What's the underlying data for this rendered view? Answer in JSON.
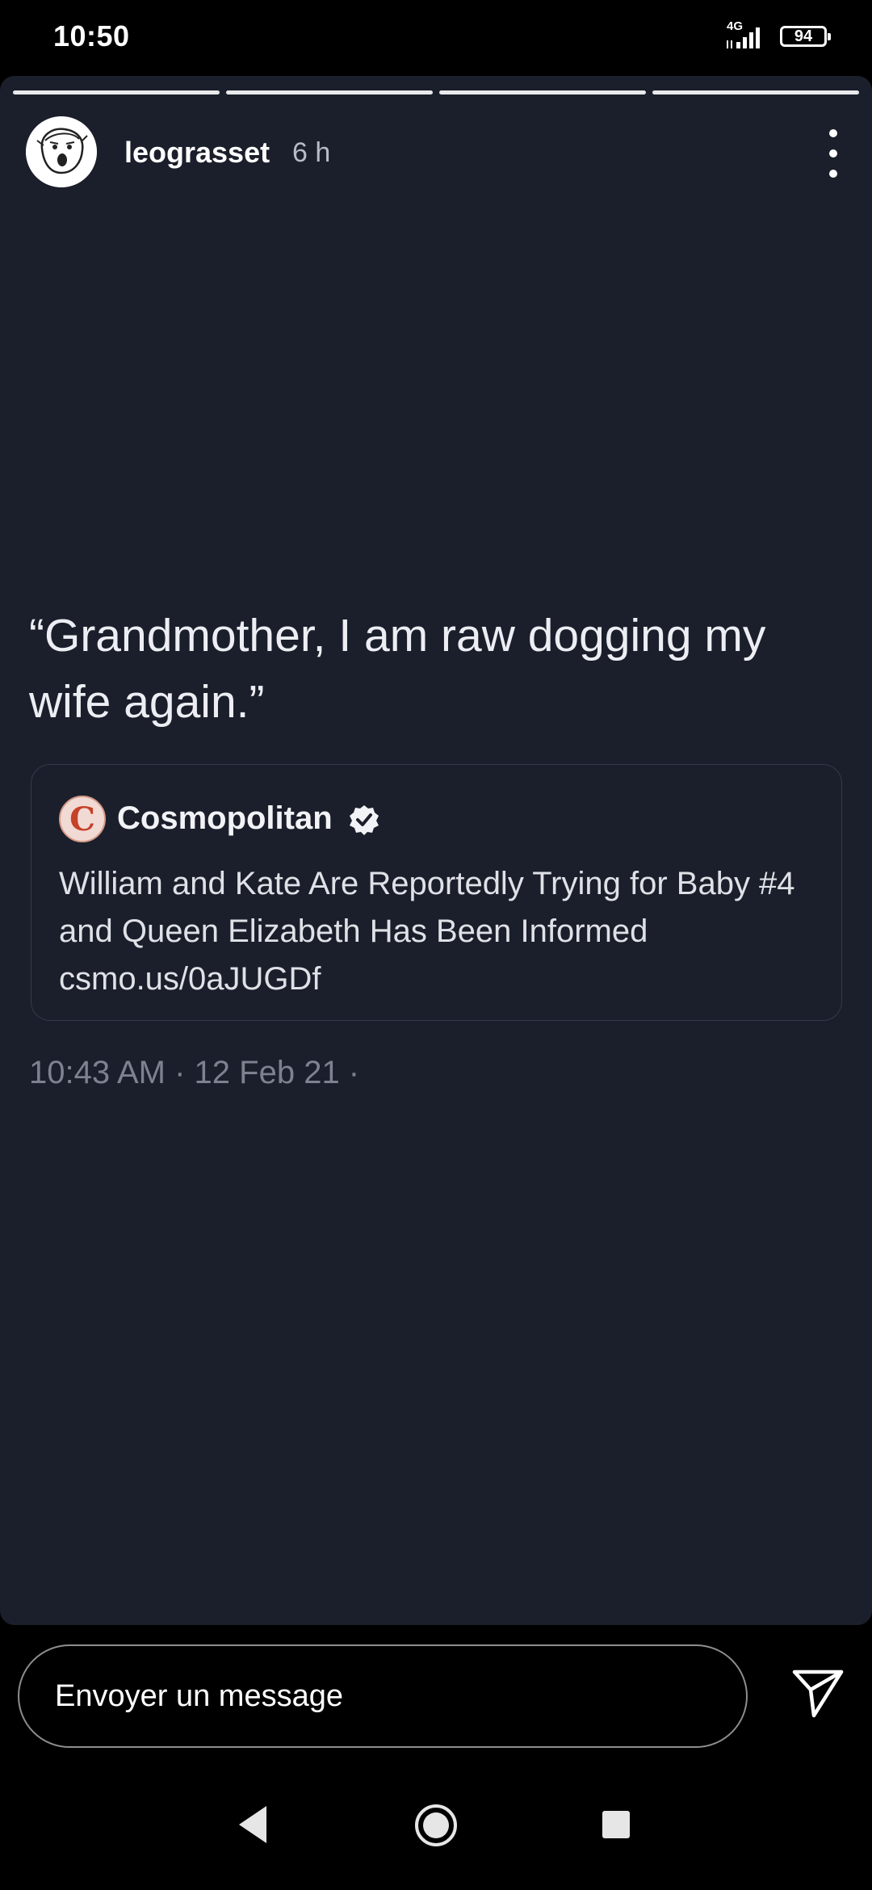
{
  "status_bar": {
    "time": "10:50",
    "network": "4G",
    "battery": "94"
  },
  "story": {
    "username": "leograsset",
    "time_ago": "6 h",
    "progress_segments": 4,
    "tweet": {
      "text": "“Grandmother, I am raw dogging my wife again.”",
      "quote": {
        "logo_letter": "C",
        "source": "Cosmopolitan",
        "body": "William and Kate Are Reportedly Trying for Baby #4 and Queen Elizabeth Has Been Informed csmo.us/0aJUGDf"
      },
      "meta": "10:43 AM · 12 Feb 21 ·"
    }
  },
  "reply": {
    "placeholder": "Envoyer un message"
  },
  "colors": {
    "story_bg": "#1b1f2b",
    "screen_bg": "#000000",
    "text_primary": "#eceef3",
    "text_muted": "#7d8290"
  },
  "icons": [
    "network-signal-icon",
    "battery-icon",
    "avatar-icon",
    "more-options-icon",
    "verified-badge-icon",
    "send-icon",
    "back-icon",
    "home-icon",
    "recent-apps-icon"
  ]
}
